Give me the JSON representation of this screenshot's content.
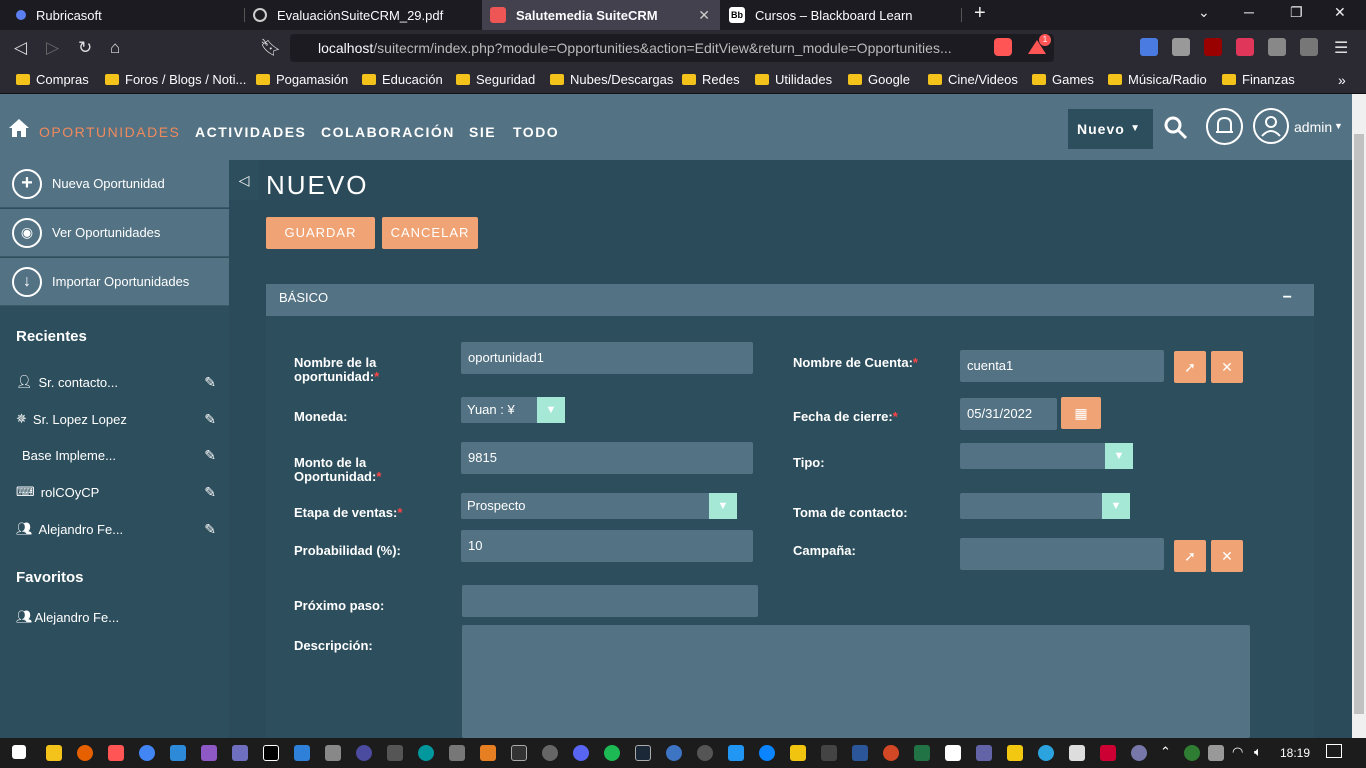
{
  "browser": {
    "tabs": [
      {
        "title": "Rubricasoft"
      },
      {
        "title": "EvaluaciónSuiteCRM_29.pdf"
      },
      {
        "title": "Salutemedia SuiteCRM"
      },
      {
        "title": "Cursos – Blackboard Learn"
      }
    ],
    "url_host": "localhost",
    "url_path": "/suitecrm/index.php?module=Opportunities&action=EditView&return_module=Opportunities...",
    "brave_badge": "1",
    "bookmarks": [
      "Compras",
      "Foros / Blogs / Noti...",
      "Pogamasión",
      "Educación",
      "Seguridad",
      "Nubes/Descargas",
      "Redes",
      "Utilidades",
      "Google",
      "Cine/Videos",
      "Games",
      "Música/Radio",
      "Finanzas"
    ]
  },
  "crm": {
    "menu": [
      "OPORTUNIDADES",
      "ACTIVIDADES",
      "COLABORACIÓN",
      "SIE",
      "TODO"
    ],
    "nuevo_label": "Nuevo",
    "user_label": "admin",
    "side_actions": [
      "Nueva Oportunidad",
      "Ver Oportunidades",
      "Importar Oportunidades"
    ],
    "recientes_title": "Recientes",
    "recientes": [
      "Sr. contacto...",
      "Sr. Lopez Lopez",
      "Base Impleme...",
      "rolCOyCP",
      "Alejandro Fe..."
    ],
    "favoritos_title": "Favoritos",
    "favoritos": [
      "Alejandro Fe..."
    ],
    "page_title": "NUEVO",
    "save_label": "GUARDAR",
    "cancel_label": "CANCELAR",
    "panel_title": "BÁSICO",
    "labels": {
      "nombre_op_1": "Nombre de la",
      "nombre_op_2": "oportunidad:",
      "moneda": "Moneda:",
      "monto_1": "Monto de la",
      "monto_2": "Oportunidad:",
      "etapa": "Etapa de ventas:",
      "probabilidad": "Probabilidad (%):",
      "proximo": "Próximo paso:",
      "descripcion": "Descripción:",
      "cuenta": "Nombre de Cuenta:",
      "fecha": "Fecha de cierre:",
      "tipo": "Tipo:",
      "toma": "Toma de contacto:",
      "campana": "Campaña:",
      "required_mark": "*"
    },
    "values": {
      "nombre_op": "oportunidad1",
      "moneda": "Yuan : ¥",
      "monto": "9815",
      "etapa": "Prospecto",
      "probabilidad": "10",
      "proximo": "",
      "descripcion": "",
      "cuenta": "cuenta1",
      "fecha": "05/31/2022",
      "tipo": "",
      "toma": "",
      "campana": ""
    }
  },
  "taskbar": {
    "time": "18:19"
  },
  "colors": {
    "accent": "#f0a374",
    "topbar": "#537283",
    "panel": "#2d4e5c",
    "select_arrow": "#a5e8d6"
  }
}
